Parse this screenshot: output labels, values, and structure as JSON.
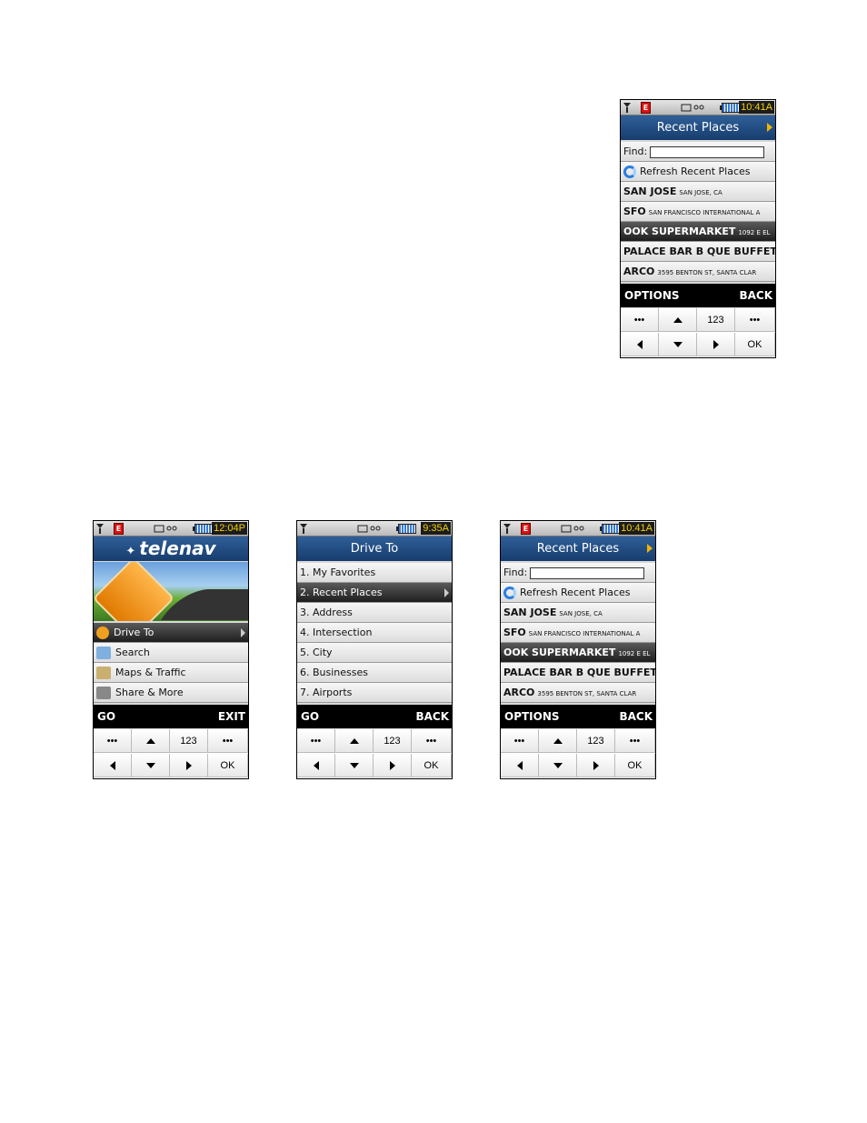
{
  "phones": {
    "large_recent": {
      "status": {
        "time": "10:41A"
      },
      "title": "Recent Places",
      "find_label": "Find:",
      "refresh_label": "Refresh Recent Places",
      "rows": [
        {
          "big": "SAN JOSE",
          "small": "SAN JOSE, CA"
        },
        {
          "big": "SFO",
          "small": "SAN FRANCISCO INTERNATIONAL A"
        },
        {
          "big": "OOK SUPERMARKET",
          "small": "1092 E EL"
        },
        {
          "big": "PALACE BAR B QUE BUFFET",
          "small": ""
        },
        {
          "big": "ARCO",
          "small": "3595 BENTON ST, SANTA CLAR"
        }
      ],
      "softkeys": {
        "left": "OPTIONS",
        "right": "BACK"
      }
    },
    "telenav": {
      "status": {
        "time": "12:04P"
      },
      "logo": "telenav",
      "menu": [
        {
          "label": "Drive To",
          "icon": "drive-to-icon"
        },
        {
          "label": "Search",
          "icon": "search-icon"
        },
        {
          "label": "Maps & Traffic",
          "icon": "map-icon"
        },
        {
          "label": "Share & More",
          "icon": "share-icon"
        }
      ],
      "softkeys": {
        "left": "GO",
        "right": "EXIT"
      }
    },
    "drive_to": {
      "status": {
        "time": "9:35A"
      },
      "title": "Drive To",
      "items": [
        "1. My Favorites",
        "2. Recent Places",
        "3. Address",
        "4. Intersection",
        "5. City",
        "6. Businesses",
        "7. Airports"
      ],
      "softkeys": {
        "left": "GO",
        "right": "BACK"
      }
    },
    "small_recent": {
      "status": {
        "time": "10:41A"
      },
      "title": "Recent Places",
      "find_label": "Find:",
      "refresh_label": "Refresh Recent Places",
      "rows": [
        {
          "big": "SAN JOSE",
          "small": "SAN JOSE, CA"
        },
        {
          "big": "SFO",
          "small": "SAN FRANCISCO INTERNATIONAL A"
        },
        {
          "big": "OOK SUPERMARKET",
          "small": "1092 E EL"
        },
        {
          "big": "PALACE BAR B QUE BUFFET",
          "small": ""
        },
        {
          "big": "ARCO",
          "small": "3595 BENTON ST, SANTA CLAR"
        }
      ],
      "softkeys": {
        "left": "OPTIONS",
        "right": "BACK"
      }
    }
  },
  "keypad": {
    "menu_key": "•••",
    "num_key": "123",
    "ok_key": "OK"
  },
  "colors": {
    "title_bar": "#1f4a80",
    "clock_text": "#f5d000",
    "selected_row": "#2a2a2a",
    "accent_arrow": "#f2b400"
  }
}
